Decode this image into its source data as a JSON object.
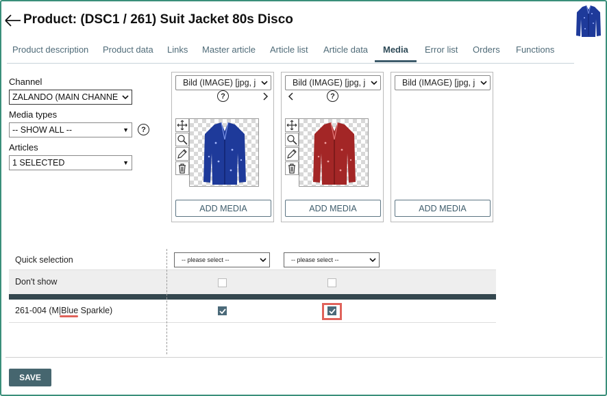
{
  "header": {
    "title": "Product: (DSC1 / 261) Suit Jacket 80s Disco"
  },
  "tabs": [
    {
      "label": "Product description"
    },
    {
      "label": "Product data"
    },
    {
      "label": "Links"
    },
    {
      "label": "Master article"
    },
    {
      "label": "Article list"
    },
    {
      "label": "Article data"
    },
    {
      "label": "Media",
      "active": true
    },
    {
      "label": "Error list"
    },
    {
      "label": "Orders"
    },
    {
      "label": "Functions"
    }
  ],
  "filters": {
    "channel_label": "Channel",
    "channel_value": "ZALANDO (MAIN CHANNE",
    "media_types_label": "Media types",
    "media_types_value": "-- SHOW ALL --",
    "articles_label": "Articles",
    "articles_value": "1 SELECTED"
  },
  "media_cards": [
    {
      "type_select": "Bild (IMAGE)   [jpg, j",
      "image_color": "#1e3a9a",
      "add_label": "ADD MEDIA"
    },
    {
      "type_select": "Bild (IMAGE)   [jpg, j",
      "image_color": "#a32626",
      "add_label": "ADD MEDIA"
    },
    {
      "type_select": "Bild (IMAGE)   [jpg, j",
      "add_label": "ADD MEDIA"
    }
  ],
  "help_symbol": "?",
  "table": {
    "quick_selection_label": "Quick selection",
    "quick_select_placeholder": "-- please select --",
    "dont_show_label": "Don't show",
    "article_row": {
      "label": "261-004 (M|Blue Sparkle)",
      "label_prefix": "261-004 (M|",
      "label_highlight": "Blue",
      "label_suffix": " Sparkle)"
    }
  },
  "save_label": "SAVE",
  "colors": {
    "accent": "#3e5c6b",
    "highlight_border": "#e0625a",
    "window_border": "#3a8f7a"
  }
}
